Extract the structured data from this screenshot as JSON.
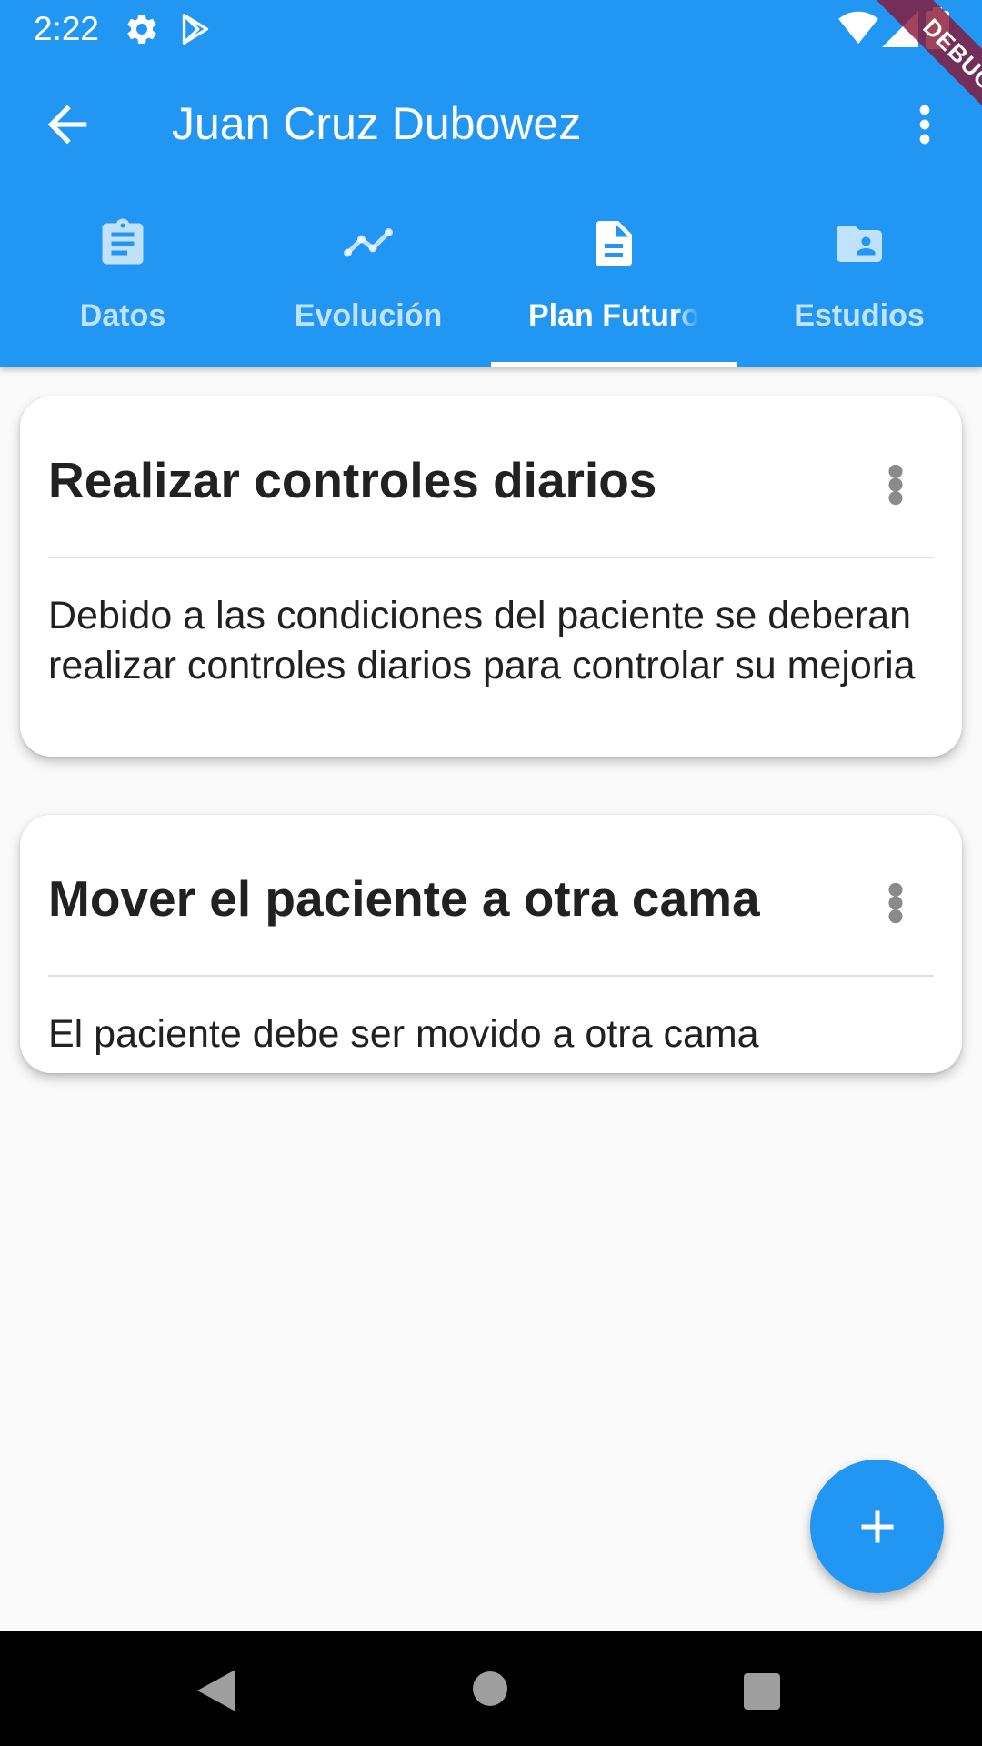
{
  "status_bar": {
    "time": "2:22",
    "icons": [
      "settings-icon",
      "play-store-icon",
      "wifi-icon",
      "signal-icon",
      "battery-icon"
    ]
  },
  "debug_banner": "DEBUG",
  "app_bar": {
    "title": "Juan Cruz Dubowez",
    "back_icon": "arrow-back-icon",
    "menu_icon": "more-vert-icon",
    "background_color": "#2196f3"
  },
  "tabs": [
    {
      "label": "Datos",
      "icon": "assignment-icon",
      "active": false
    },
    {
      "label": "Evolución",
      "icon": "timeline-icon",
      "active": false
    },
    {
      "label": "Plan Futuro",
      "icon": "description-icon",
      "active": true
    },
    {
      "label": "Estudios",
      "icon": "folder-shared-icon",
      "active": false
    }
  ],
  "cards": [
    {
      "title": "Realizar controles diarios",
      "body": "Debido a las condiciones del paciente se deberan realizar controles diarios para controlar su mejoria"
    },
    {
      "title": "Mover el paciente a otra cama",
      "body": "El paciente debe ser movido a otra cama"
    }
  ],
  "fab": {
    "icon": "add-icon"
  },
  "nav_bar": {
    "icons": [
      "back-triangle-icon",
      "home-circle-icon",
      "recents-square-icon"
    ]
  }
}
